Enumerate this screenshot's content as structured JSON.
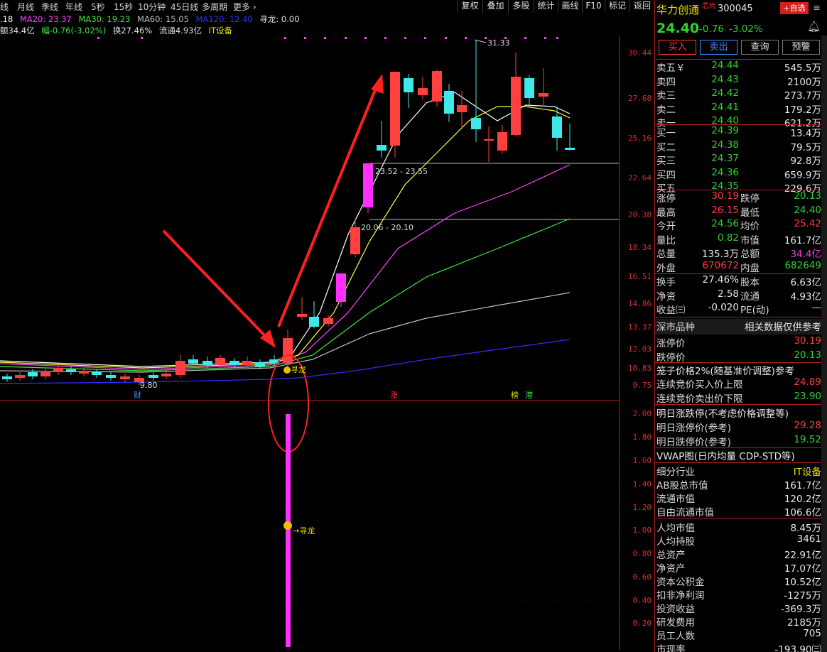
{
  "toolbar": {
    "periods": [
      "线",
      "月线",
      "季线",
      "年线",
      "5秒",
      "15秒",
      "10分钟",
      "45日线",
      "多周期",
      "更多 ›"
    ],
    "right_buttons": [
      "复权",
      "叠加",
      "多股",
      "统计",
      "画线",
      "F10",
      "标记",
      "返回"
    ]
  },
  "ma_row": {
    "ma5": ".18",
    "ma20": "MA20: 23.37",
    "ma30": "MA30: 19.23",
    "ma60": "MA60: 15.05",
    "ma120": "MA120: 12.40",
    "xunlong": "寻龙: 0.00"
  },
  "info_row": {
    "amount": "额34.4亿",
    "change": "幅-0.76(-3.02%)",
    "turnover": "换27.46%",
    "float": "流通4.93亿",
    "industry": "IT设备"
  },
  "chart_data": {
    "type": "candlestick",
    "price_axis_ticks": [
      "30.44",
      "27.68",
      "25.16",
      "22.64",
      "20.38",
      "18.34",
      "16.51",
      "14.86",
      "13.37",
      "12.03",
      "10.83",
      "9.75"
    ],
    "indicator_axis_ticks": [
      "2.00",
      "1.80",
      "1.60",
      "1.40",
      "1.20",
      "1.00",
      "0.80",
      "0.60",
      "0.40",
      "0.20"
    ],
    "annotations": {
      "high": "31.33",
      "low": "9.80",
      "level1": "23.52 - 23.55",
      "level2": "20.06 - 20.10",
      "signal": "寻龙",
      "signal2": "→寻龙",
      "marker_cai": "财",
      "marker_zhang": "涨",
      "marker_bang": "榜",
      "marker_gang": "港"
    },
    "colors": {
      "up": "#ff4040",
      "down": "#40e8e8",
      "limit_up": "#ff30ff",
      "ma5": "#ffffff",
      "ma10": "#ffff40",
      "ma20": "#ff40ff",
      "ma30": "#40e840",
      "ma60": "#c0c0c0",
      "ma120": "#3030ff"
    }
  },
  "quote": {
    "name": "华力创通",
    "tag": "芯片",
    "code": "300045",
    "add_btn": "+自选",
    "price": "24.40",
    "change": "-0.76",
    "pct": "-3.02%",
    "buttons": [
      "买入",
      "卖出",
      "查询",
      "预警"
    ],
    "asks": [
      {
        "label": "卖五￥",
        "price": "24.44",
        "vol": "545.5万"
      },
      {
        "label": "卖四",
        "price": "24.43",
        "vol": "2100万"
      },
      {
        "label": "卖三",
        "price": "24.42",
        "vol": "273.7万"
      },
      {
        "label": "卖二",
        "price": "24.41",
        "vol": "179.2万"
      },
      {
        "label": "卖一",
        "price": "24.40",
        "vol": "621.2万"
      }
    ],
    "bids": [
      {
        "label": "买一",
        "price": "24.39",
        "vol": "13.4万"
      },
      {
        "label": "买二",
        "price": "24.38",
        "vol": "79.5万"
      },
      {
        "label": "买三",
        "price": "24.37",
        "vol": "92.8万"
      },
      {
        "label": "买四",
        "price": "24.36",
        "vol": "659.9万"
      },
      {
        "label": "买五",
        "price": "24.35",
        "vol": "229.6万"
      }
    ],
    "stats": [
      {
        "l1": "涨停",
        "v1": "30.19",
        "l2": "跌停",
        "v2": "20.13",
        "c1": "red",
        "c2": "green"
      },
      {
        "l1": "最高",
        "v1": "26.15",
        "l2": "最低",
        "v2": "24.40",
        "c1": "red",
        "c2": "green"
      },
      {
        "l1": "今开",
        "v1": "24.56",
        "l2": "均价",
        "v2": "25.42",
        "c1": "green",
        "c2": "red"
      },
      {
        "l1": "量比",
        "v1": "0.82",
        "l2": "市值",
        "v2": "161.7亿",
        "c1": "green",
        "c2": "white"
      },
      {
        "l1": "总量",
        "v1": "135.3万",
        "l2": "总额",
        "v2": "34.4亿",
        "c1": "white",
        "c2": "mag"
      },
      {
        "l1": "外盘",
        "v1": "670672",
        "l2": "内盘",
        "v2": "682649",
        "c1": "red",
        "c2": "green"
      }
    ],
    "stats2": [
      {
        "l1": "换手",
        "v1": "27.46%",
        "l2": "股本",
        "v2": "6.63亿"
      },
      {
        "l1": "净资",
        "v1": "2.58",
        "l2": "流通",
        "v2": "4.93亿"
      },
      {
        "l1": "收益㈢",
        "v1": "-0.020",
        "l2": "PE(动)",
        "v2": "—"
      }
    ],
    "market_title": "深市品种",
    "market_note": "相关数据仅供参考",
    "limit_rows": [
      {
        "label": "涨停价",
        "value": "30.19",
        "c": "red"
      },
      {
        "label": "跌停价",
        "value": "20.13",
        "c": "green"
      }
    ],
    "cage_title": "笼子价格2%(随基准价调整)参考",
    "cage_rows": [
      {
        "label": "连续竞价买入价上限",
        "value": "24.89",
        "c": "red"
      },
      {
        "label": "连续竞价卖出价下限",
        "value": "23.90",
        "c": "green"
      }
    ],
    "next_title": "明日涨跌停(不考虑价格调整等)",
    "next_rows": [
      {
        "label": "明日涨停价(参考)",
        "value": "29.28",
        "c": "red"
      },
      {
        "label": "明日跌停价(参考)",
        "value": "19.52",
        "c": "green"
      }
    ],
    "vwap_title": "VWAP图(日内均量 CDP-STD等)",
    "fund_rows": [
      {
        "label": "细分行业",
        "value": "IT设备",
        "c": "yellow"
      },
      {
        "label": "AB股总市值",
        "value": "161.7亿",
        "c": "white"
      },
      {
        "label": "流通市值",
        "value": "120.2亿",
        "c": "white"
      },
      {
        "label": "自由流通市值",
        "value": "106.6亿",
        "c": "white"
      },
      {
        "label": "人均市值",
        "value": "8.45万",
        "c": "white"
      },
      {
        "label": "人均持股",
        "value": "3461",
        "c": "white"
      },
      {
        "label": "总资产",
        "value": "22.91亿",
        "c": "white"
      },
      {
        "label": "净资产",
        "value": "17.07亿",
        "c": "white"
      },
      {
        "label": "资本公积金",
        "value": "10.52亿",
        "c": "white"
      },
      {
        "label": "扣非净利润",
        "value": "-1275万",
        "c": "white"
      },
      {
        "label": "投资收益",
        "value": "-369.3万",
        "c": "white"
      },
      {
        "label": "研发费用",
        "value": "2185万",
        "c": "white"
      },
      {
        "label": "员工人数",
        "value": "705",
        "c": "white"
      },
      {
        "label": "市现率",
        "value": "-193.90㈢",
        "c": "white"
      }
    ]
  }
}
